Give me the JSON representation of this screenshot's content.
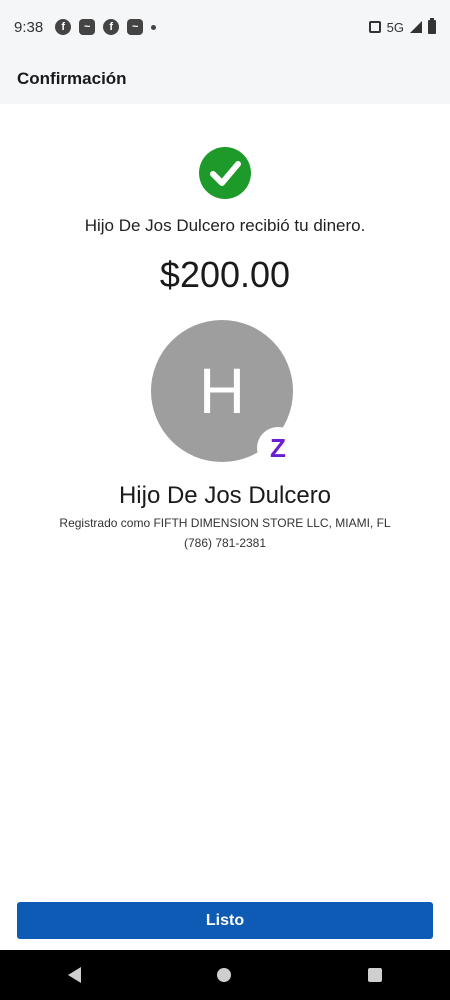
{
  "status_bar": {
    "time": "9:38",
    "network": "5G",
    "notification_icons": [
      "facebook-icon",
      "app-notification-icon",
      "facebook-icon",
      "app-notification-icon"
    ]
  },
  "header": {
    "title": "Confirmación"
  },
  "confirmation": {
    "message": "Hijo De Jos Dulcero recibió tu dinero.",
    "amount": "$200.00",
    "success_color": "#1e9a2b"
  },
  "recipient": {
    "initial": "H",
    "name": "Hijo De Jos Dulcero",
    "registered_as": "Registrado como FIFTH DIMENSION STORE LLC, MIAMI, FL",
    "phone": "(786) 781-2381",
    "badge": "Z",
    "badge_color": "#6d1ed4"
  },
  "actions": {
    "done_label": "Listo",
    "accent_color": "#0d5bb5"
  }
}
